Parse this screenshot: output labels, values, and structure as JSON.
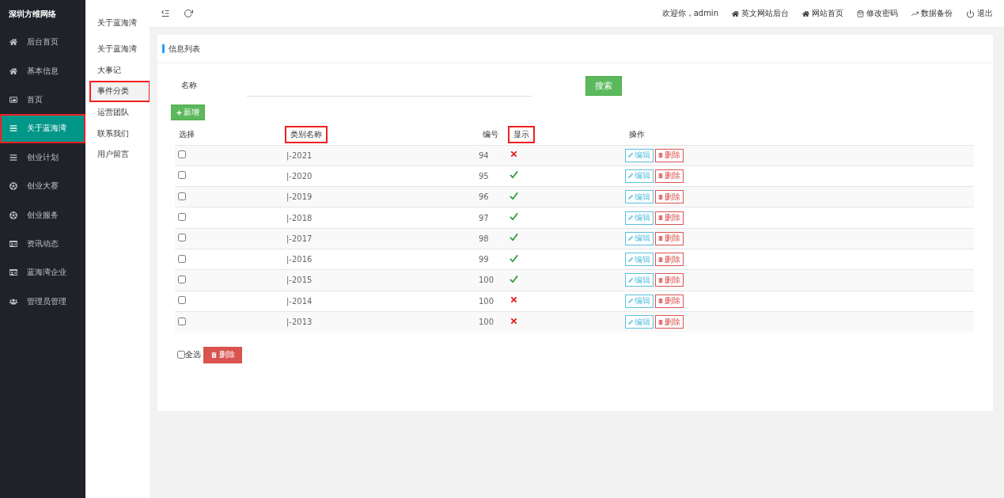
{
  "brand": "深圳方维网络",
  "sidebar": {
    "items": [
      {
        "label": "后台首页",
        "selected": false,
        "marked": false
      },
      {
        "label": "基本信息",
        "selected": false,
        "marked": false
      },
      {
        "label": "首页",
        "selected": false,
        "marked": false
      },
      {
        "label": "关于蓝海湾",
        "selected": true,
        "marked": true
      },
      {
        "label": "创业计划",
        "selected": false,
        "marked": false
      },
      {
        "label": "创业大赛",
        "selected": false,
        "marked": false
      },
      {
        "label": "创业服务",
        "selected": false,
        "marked": false
      },
      {
        "label": "资讯动态",
        "selected": false,
        "marked": false
      },
      {
        "label": "蓝海湾企业",
        "selected": false,
        "marked": false
      },
      {
        "label": "管理员管理",
        "selected": false,
        "marked": false
      }
    ]
  },
  "submenu": {
    "title": "关于蓝海湾",
    "items": [
      {
        "label": "关于蓝海湾",
        "selected": false,
        "marked": false
      },
      {
        "label": "大事记",
        "selected": false,
        "marked": false
      },
      {
        "label": "事件分类",
        "selected": true,
        "marked": true
      },
      {
        "label": "运营团队",
        "selected": false,
        "marked": false
      },
      {
        "label": "联系我们",
        "selected": false,
        "marked": false
      },
      {
        "label": "用户留言",
        "selected": false,
        "marked": false
      }
    ]
  },
  "topbar": {
    "welcome": "欢迎你，admin",
    "links": [
      "英文网站后台",
      "网站首页",
      "修改密码",
      "数据备份",
      "退出"
    ]
  },
  "panel": {
    "title": "信息列表",
    "search": {
      "label": "名称",
      "button": "搜索"
    },
    "add_button": "新增",
    "table": {
      "columns": [
        {
          "label": "选择",
          "marked": false
        },
        {
          "label": "类别名称",
          "marked": true
        },
        {
          "label": "编号",
          "marked": false
        },
        {
          "label": "显示",
          "marked": true
        },
        {
          "label": "操作",
          "marked": false
        }
      ],
      "rows": [
        {
          "checked": false,
          "name": "|-2021",
          "number": "94",
          "shown": false,
          "edit": "编辑",
          "delete": "删除"
        },
        {
          "checked": false,
          "name": "|-2020",
          "number": "95",
          "shown": true,
          "edit": "编辑",
          "delete": "删除"
        },
        {
          "checked": false,
          "name": "|-2019",
          "number": "96",
          "shown": true,
          "edit": "编辑",
          "delete": "删除"
        },
        {
          "checked": false,
          "name": "|-2018",
          "number": "97",
          "shown": true,
          "edit": "编辑",
          "delete": "删除"
        },
        {
          "checked": false,
          "name": "|-2017",
          "number": "98",
          "shown": true,
          "edit": "编辑",
          "delete": "删除"
        },
        {
          "checked": false,
          "name": "|-2016",
          "number": "99",
          "shown": true,
          "edit": "编辑",
          "delete": "删除"
        },
        {
          "checked": false,
          "name": "|-2015",
          "number": "100",
          "shown": true,
          "edit": "编辑",
          "delete": "删除"
        },
        {
          "checked": false,
          "name": "|-2014",
          "number": "100",
          "shown": false,
          "edit": "编辑",
          "delete": "删除"
        },
        {
          "checked": false,
          "name": "|-2013",
          "number": "100",
          "shown": false,
          "edit": "编辑",
          "delete": "删除"
        }
      ]
    },
    "select_all": {
      "label": "全选",
      "checked": false
    },
    "bulk_delete": "删除"
  }
}
